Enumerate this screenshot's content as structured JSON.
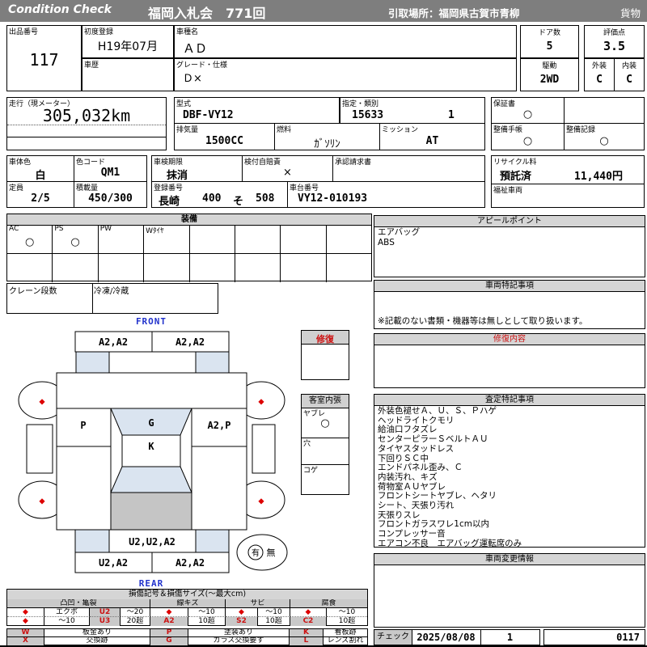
{
  "header": {
    "brand": "Condition  Check",
    "auction_title": "福岡入札会　771回",
    "pickup_place": "引取場所：福岡県古賀市青柳",
    "category": "貨物"
  },
  "top": {
    "lot_label": "出品番号",
    "lot_number": "117",
    "first_registration_label": "初度登録",
    "first_registration": "H19年07月",
    "car_history_label": "車歴",
    "car_history": "",
    "model_name_label": "車種名",
    "model_name": "ＡＤ",
    "grade_label": "グレード・仕様",
    "grade": "Ｄ×",
    "doors_label": "ドア数",
    "doors": "5",
    "score_label": "評価点",
    "score": "3.5",
    "drive_label": "駆動",
    "drive": "2WD",
    "exterior_label": "外装",
    "exterior_grade": "C",
    "interior_label": "内装",
    "interior_grade": "C"
  },
  "spec": {
    "mileage_label": "走行（現メーター）",
    "mileage": "305,032km",
    "model_code_label": "型式",
    "model_code": "DBF-VY12",
    "designation_label": "指定・類別",
    "designation_no": "15633",
    "class_no": "1",
    "warranty_label": "保証書",
    "warranty": "○",
    "displacement_label": "排気量",
    "displacement": "1500CC",
    "fuel_label": "燃料",
    "fuel": "ｶﾞｿﾘﾝ",
    "transmission_label": "ミッション",
    "transmission": "AT",
    "maintenance_book_label": "整備手帳",
    "maintenance_book": "○",
    "maintenance_record_label": "整備記録",
    "maintenance_record": "○"
  },
  "body_info": {
    "color_label": "車体色",
    "color": "白",
    "color_code_label": "色コード",
    "color_code": "QM1",
    "inspection_label": "車検期限",
    "inspection": "抹消",
    "insurance_label": "検付自賠責",
    "insurance": "×",
    "approval_label": "承認請求書",
    "approval": "",
    "capacity_label": "定員",
    "capacity": "2/5",
    "load_label": "積載量",
    "load": "450/300",
    "registration_label": "登録番号",
    "reg_region": "長崎",
    "reg_class": "400",
    "reg_kana": "そ",
    "reg_number": "508",
    "chassis_label": "車台番号",
    "chassis_no": "VY12-010193",
    "recycle_label": "リサイクル料",
    "recycle_status": "預託済",
    "recycle_fee": "11,440円",
    "welfare_label": "福祉車両",
    "welfare": ""
  },
  "equipment": {
    "title": "装備",
    "cols": [
      "AC",
      "PS",
      "PW",
      "Wﾀｲﾔ",
      "",
      "",
      "",
      ""
    ],
    "row1": [
      "○",
      "○",
      "",
      "",
      "",
      "",
      "",
      ""
    ],
    "row2": [
      "",
      "",
      "",
      "",
      "",
      "",
      "",
      ""
    ],
    "crane_label": "クレーン段数",
    "crane": "",
    "refrigeration_label": "冷凍/冷蔵",
    "refrigeration": ""
  },
  "appeal": {
    "title": "アピールポイント",
    "items": [
      "エアバッグ",
      "ABS"
    ]
  },
  "vehicle_notes": {
    "title": "車両特記事項",
    "note": "※記載のない書類・機器等は無しとして取り扱います。"
  },
  "repair": {
    "box_title": "修復",
    "section_title": "修復内容",
    "content": ""
  },
  "cabin": {
    "title": "客室内張",
    "tear_label": "ヤブレ",
    "tear": "○",
    "hole_label": "穴",
    "hole": "",
    "burn_label": "コゲ",
    "burn": ""
  },
  "assessment": {
    "title": "査定特記事項",
    "items": [
      "外装色褪せＡ、Ｕ、Ｓ、Ｐハゲ",
      "ヘッドライトクモリ",
      "給油口フタズレ",
      "センターピラーＳベルトＡＵ",
      "タイヤスタッドレス",
      "下回りＳＣ中",
      "エンドパネル歪み、Ｃ",
      "内装汚れ、キズ",
      "荷物室ＡＵヤブレ",
      "フロントシートヤブレ、ヘタリ",
      "シート、天張り汚れ",
      "天張りスレ",
      "フロントガラスワレ1cm以内",
      "コンプレッサー音",
      "エアコン不良　エアバッグ運転席のみ"
    ]
  },
  "changes": {
    "title": "車両変更情報",
    "content": ""
  },
  "diagram": {
    "front_label": "FRONT",
    "rear_label": "REAR",
    "front_bumper_left": "A2,A2",
    "front_bumper_right": "A2,A2",
    "left_side": "P",
    "windshield": "G",
    "right_side": "A2,P",
    "roof": "K",
    "rear_panel": "U2,U2,A2",
    "rear_bumper_left": "U2,A2",
    "rear_bumper_right": "A2,A2",
    "spare_yes": "有",
    "spare_no": "無",
    "wheel_mark": "◆"
  },
  "legend": {
    "title": "損傷記号＆損傷サイズ(～最大cm)",
    "dent": {
      "name": "凸凹・亀裂",
      "r1": [
        "◆",
        "エクボ",
        "U2",
        "～20"
      ],
      "r2": [
        "◆",
        "～10",
        "U3",
        "20超"
      ]
    },
    "scratch": {
      "name": "線キズ",
      "r1": [
        "◆",
        "～10"
      ],
      "r2": [
        "A2",
        "10超"
      ]
    },
    "rust": {
      "name": "サビ",
      "r1": [
        "◆",
        "～10"
      ],
      "r2": [
        "S2",
        "10超"
      ]
    },
    "corrosion": {
      "name": "腐食",
      "r1": [
        "◆",
        "～10"
      ],
      "r2": [
        "C2",
        "10超"
      ]
    },
    "codes": {
      "w": {
        "code": "W",
        "desc": "板金あり"
      },
      "p": {
        "code": "P",
        "desc": "塗装あり"
      },
      "k": {
        "code": "K",
        "desc": "看板跡"
      },
      "x": {
        "code": "X",
        "desc": "交換跡"
      },
      "g": {
        "code": "G",
        "desc": "ガラス交換要す"
      },
      "l": {
        "code": "L",
        "desc": "レンズ割れ"
      }
    }
  },
  "footer": {
    "check_label": "チェック",
    "check_date": "2025/08/08",
    "check_count": "1",
    "sheet_no": "0117"
  },
  "colors": {
    "header_bg": "#7e7e7e",
    "panel_header_bg": "#d5d5d5",
    "accent_red": "#cc1111",
    "accent_blue": "#2233cc",
    "shade_blue": "#dae4f0",
    "shade_gray": "#c5c5c5",
    "diamond_red": "#dd0000"
  }
}
